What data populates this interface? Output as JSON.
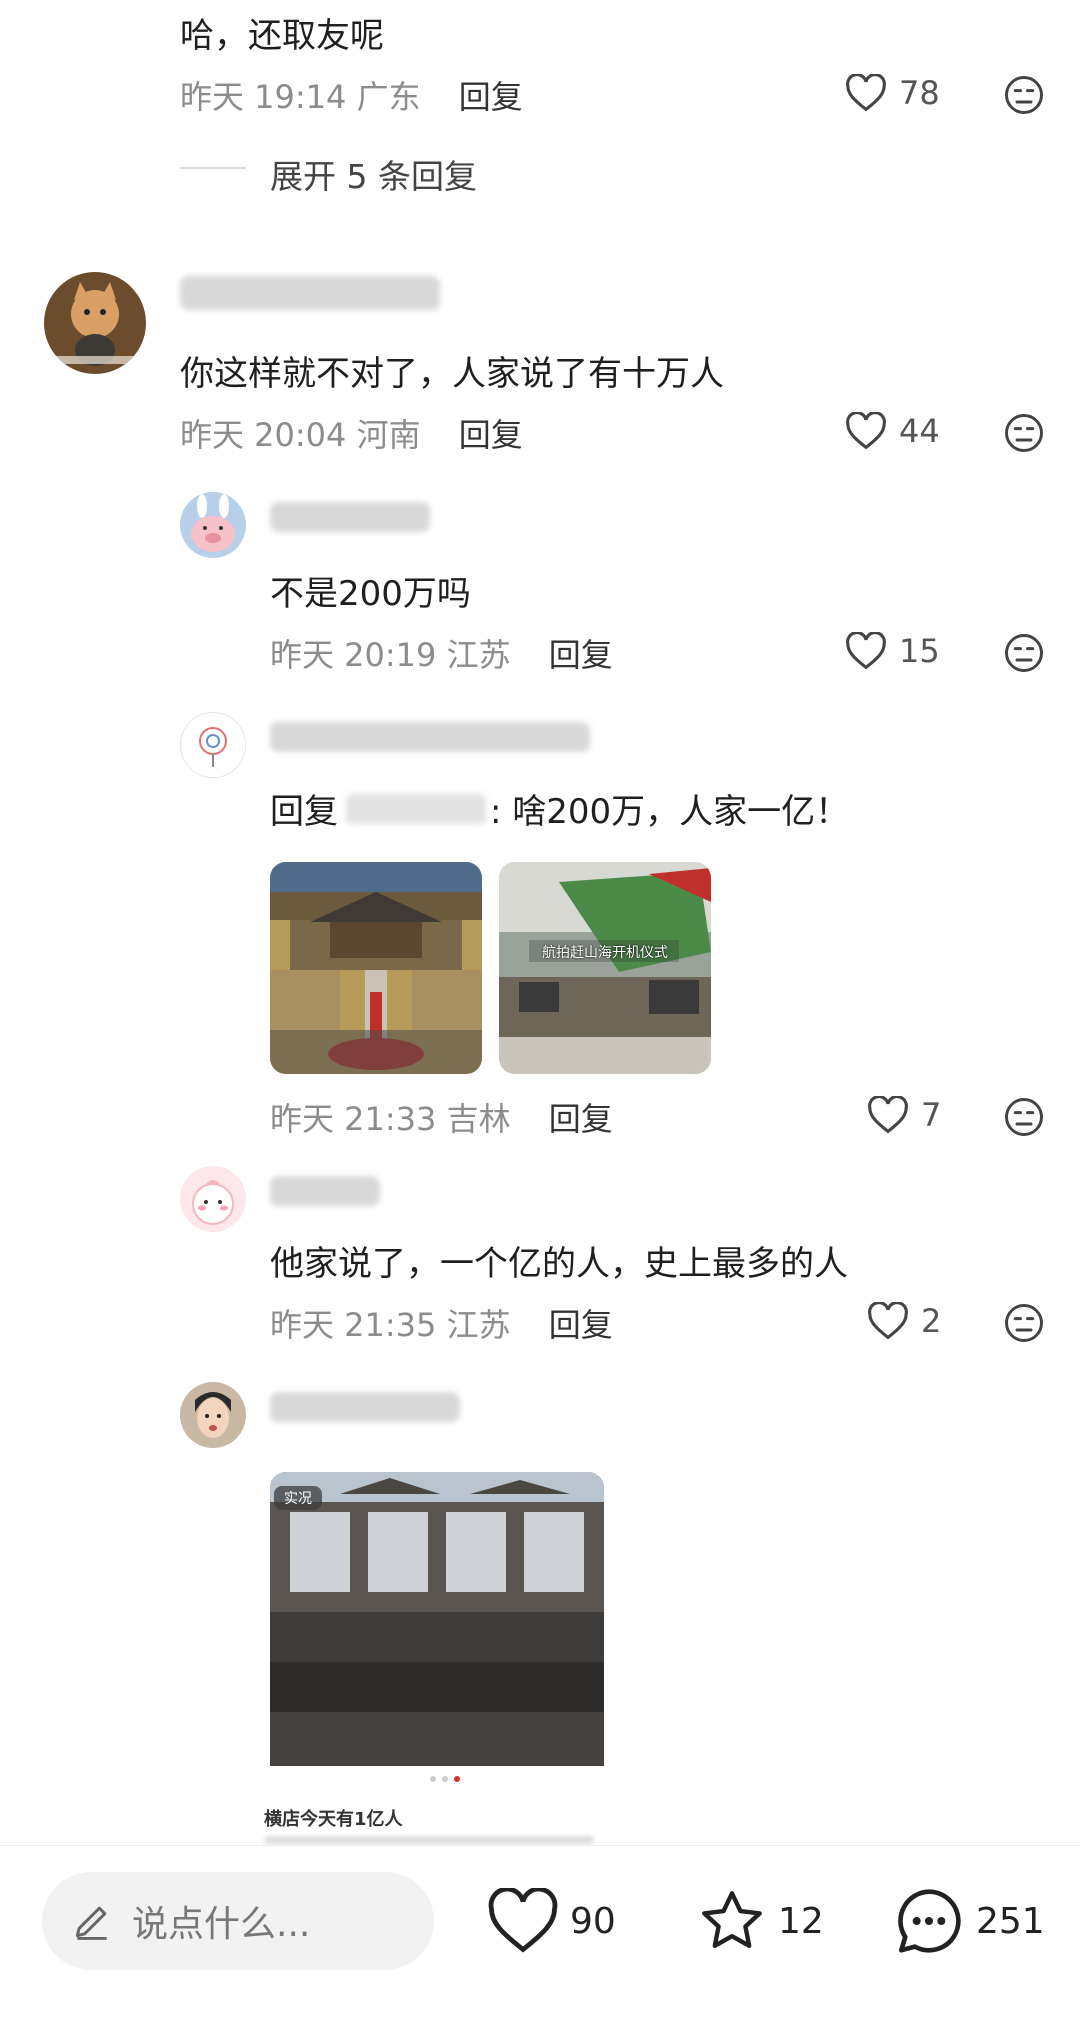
{
  "comments": [
    {
      "text": "哈，还取友呢",
      "time": "昨天 19:14",
      "region": "广东",
      "reply_label": "回复",
      "likes": "78",
      "expand_label": "展开 5 条回复"
    },
    {
      "username": "",
      "text": "你这样就不对了，人家说了有十万人",
      "time": "昨天 20:04",
      "region": "河南",
      "reply_label": "回复",
      "likes": "44"
    },
    {
      "username": "",
      "text": "不是200万吗",
      "time": "昨天 20:19",
      "region": "江苏",
      "reply_label": "回复",
      "likes": "15"
    },
    {
      "username": "",
      "reply_prefix": "回复",
      "text": ": 啥200万，人家一亿！",
      "image_caption": "航拍赶山海开机仪式",
      "time": "昨天 21:33",
      "region": "吉林",
      "reply_label": "回复",
      "likes": "7"
    },
    {
      "username": "",
      "text": "他家说了，一个亿的人，史上最多的人",
      "time": "昨天 21:35",
      "region": "江苏",
      "reply_label": "回复",
      "likes": "2"
    },
    {
      "username": "",
      "image_badge": "实况",
      "card_caption": "横店今天有1亿人"
    }
  ],
  "bottom_bar": {
    "input_placeholder": "说点什么...",
    "likes": "90",
    "favorites": "12",
    "comments": "251"
  },
  "colors": {
    "accent": "#e02e24",
    "meta_gray": "#8c8c8c",
    "input_bg": "#f2f2f2"
  }
}
